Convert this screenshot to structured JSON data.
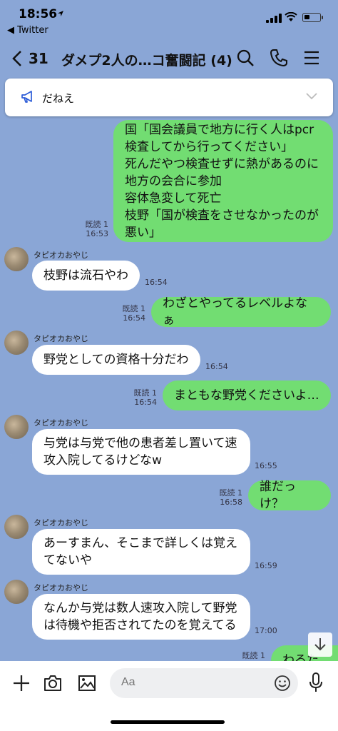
{
  "status": {
    "time": "18:56",
    "back_app": "◀ Twitter"
  },
  "header": {
    "unread_count": "31",
    "title": "ダメプ2人の…コ奮闘記 (4)"
  },
  "announcement": {
    "text": "だねえ"
  },
  "messages": [
    {
      "lines": [
        "国「国会議員で地方に行く人はpcr",
        "検査してから行ってください」",
        "死んだやつ検査せずに熱があるのに",
        "地方の会合に参加",
        "容体急変して死亡",
        "枝野「国が検査をさせなかったのが",
        "悪い」"
      ],
      "read": "既読 1",
      "time": "16:53"
    },
    {
      "sender": "タピオカおやじ",
      "lines": [
        "枝野は流石やわ"
      ],
      "time": "16:54"
    },
    {
      "lines": [
        "わざとやってるレベルよなぁ"
      ],
      "read": "既読 1",
      "time": "16:54"
    },
    {
      "sender": "タピオカおやじ",
      "lines": [
        "野党としての資格十分だわ"
      ],
      "time": "16:54"
    },
    {
      "lines": [
        "まともな野党くださいよ…"
      ],
      "read": "既読 1",
      "time": "16:54"
    },
    {
      "sender": "タピオカおやじ",
      "lines": [
        "与党は与党で他の患者差し置いて速",
        "攻入院してるけどなw"
      ],
      "time": "16:55"
    },
    {
      "lines": [
        "誰だっけ？"
      ],
      "read": "既読 1",
      "time": "16:58"
    },
    {
      "sender": "タピオカおやじ",
      "lines": [
        "あーすまん、そこまで詳しくは覚え",
        "てないや"
      ],
      "time": "16:59"
    },
    {
      "sender": "タピオカおやじ",
      "lines": [
        "なんか与党は数人速攻入院して野党",
        "は待機や拒否されてたのを覚えてる"
      ],
      "time": "17:00"
    },
    {
      "lines": [
        "わるた"
      ],
      "read": "既読 1"
    }
  ],
  "input": {
    "placeholder": "Aa"
  }
}
